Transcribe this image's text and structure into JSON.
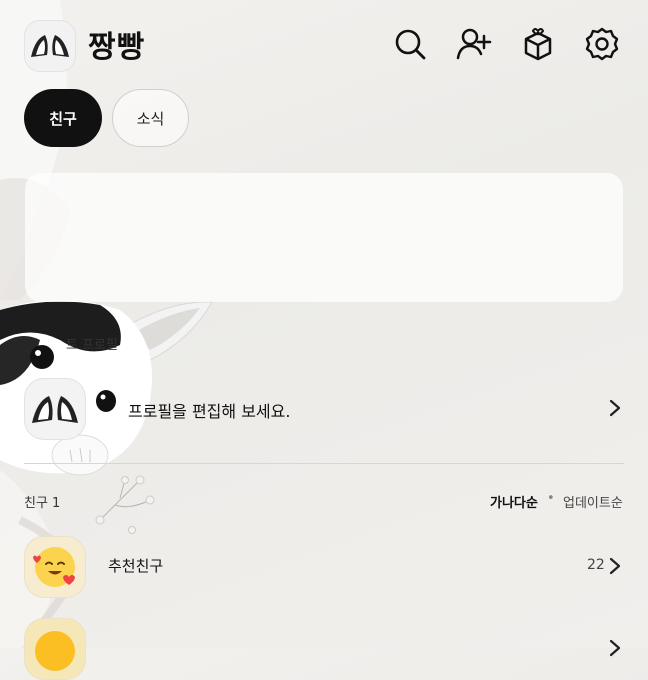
{
  "header": {
    "title": "짱빵",
    "icons": [
      "search-icon",
      "add-friend-icon",
      "gift-icon",
      "settings-icon"
    ]
  },
  "tabs": [
    {
      "label": "친구",
      "active": true
    },
    {
      "label": "소식",
      "active": false
    }
  ],
  "my_profile": {
    "section_label": "트 프로필",
    "prompt": "프로필을 편집해 보세요."
  },
  "friends": {
    "count_label": "친구 1",
    "sort_selected": "가나다순",
    "sort_separator": "•",
    "sort_other": "업데이트순",
    "items": [
      {
        "name": "추천친구",
        "count": "22"
      }
    ]
  },
  "colors": {
    "active_tab_bg": "#111111",
    "background": "#efedea"
  }
}
